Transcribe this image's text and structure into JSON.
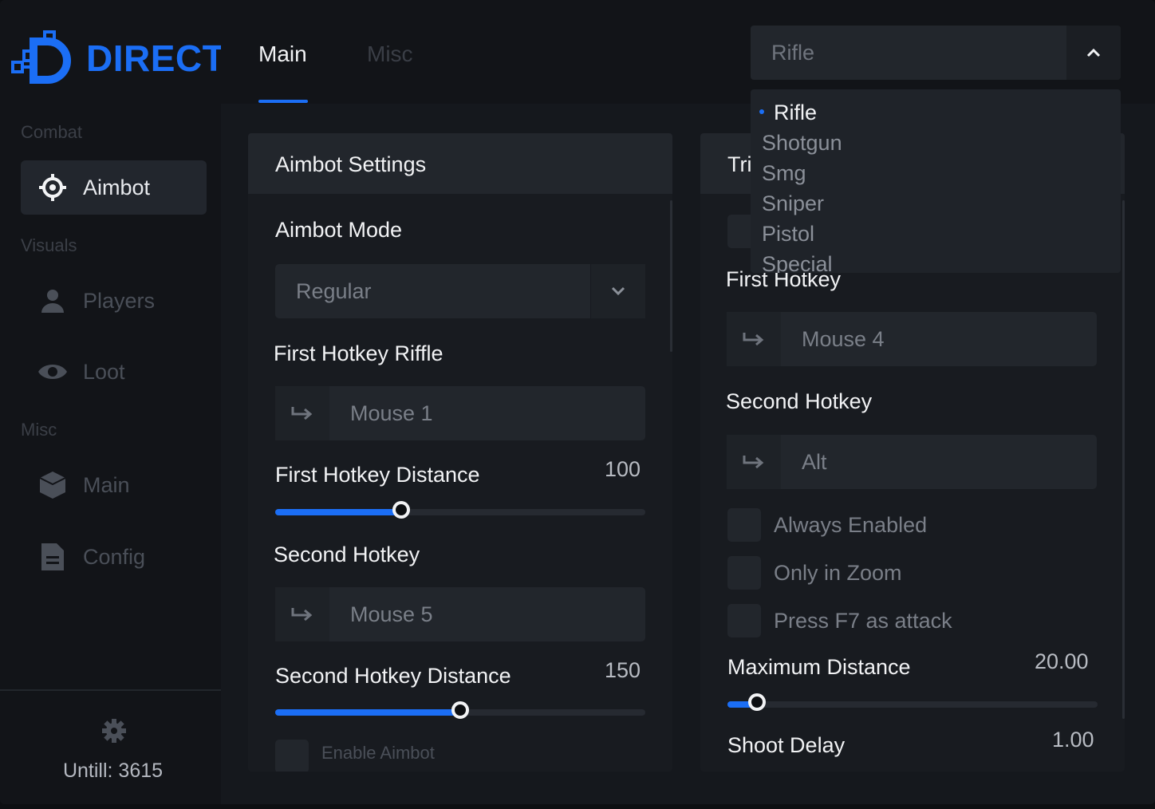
{
  "brand": {
    "name": "DIRECT",
    "accent": "#1b6ef5"
  },
  "sidebar": {
    "sections": [
      {
        "label": "Combat"
      },
      {
        "label": "Visuals"
      },
      {
        "label": "Misc"
      }
    ],
    "items": [
      {
        "label": "Aimbot",
        "icon": "crosshair-icon",
        "active": true
      },
      {
        "label": "Players",
        "icon": "user-icon"
      },
      {
        "label": "Loot",
        "icon": "eye-icon"
      },
      {
        "label": "Main",
        "icon": "cube-icon"
      },
      {
        "label": "Config",
        "icon": "file-icon"
      }
    ],
    "footer": {
      "until": "Untill: 3615",
      "icon": "gear-icon"
    }
  },
  "tabs": [
    {
      "label": "Main",
      "active": true
    },
    {
      "label": "Misc",
      "active": false
    }
  ],
  "weapon_select": {
    "value": "Rifle",
    "options": [
      "Rifle",
      "Shotgun",
      "Smg",
      "Sniper",
      "Pistol",
      "Special"
    ]
  },
  "aimbot_panel": {
    "title": "Aimbot Settings",
    "mode_label": "Aimbot Mode",
    "mode_value": "Regular",
    "first_hotkey_label": "First Hotkey Riffle",
    "first_hotkey_value": "Mouse 1",
    "first_distance_label": "First Hotkey Distance",
    "first_distance_value": "100",
    "first_distance_fill": 0.34,
    "second_hotkey_label": "Second Hotkey",
    "second_hotkey_value": "Mouse 5",
    "second_distance_label": "Second Hotkey Distance",
    "second_distance_value": "150",
    "second_distance_fill": 0.5,
    "enable_label": "Enable Aimbot"
  },
  "trigger_panel": {
    "title_partial": "Tri",
    "first_hotkey_label": "First Hotkey",
    "first_hotkey_value": "Mouse 4",
    "second_hotkey_label": "Second Hotkey",
    "second_hotkey_value": "Alt",
    "checkboxes": [
      "Always Enabled",
      "Only in Zoom",
      "Press F7 as attack"
    ],
    "max_distance_label": "Maximum Distance",
    "max_distance_value": "20.00",
    "max_distance_fill": 0.08,
    "shoot_delay_label": "Shoot Delay",
    "shoot_delay_value": "1.00"
  }
}
